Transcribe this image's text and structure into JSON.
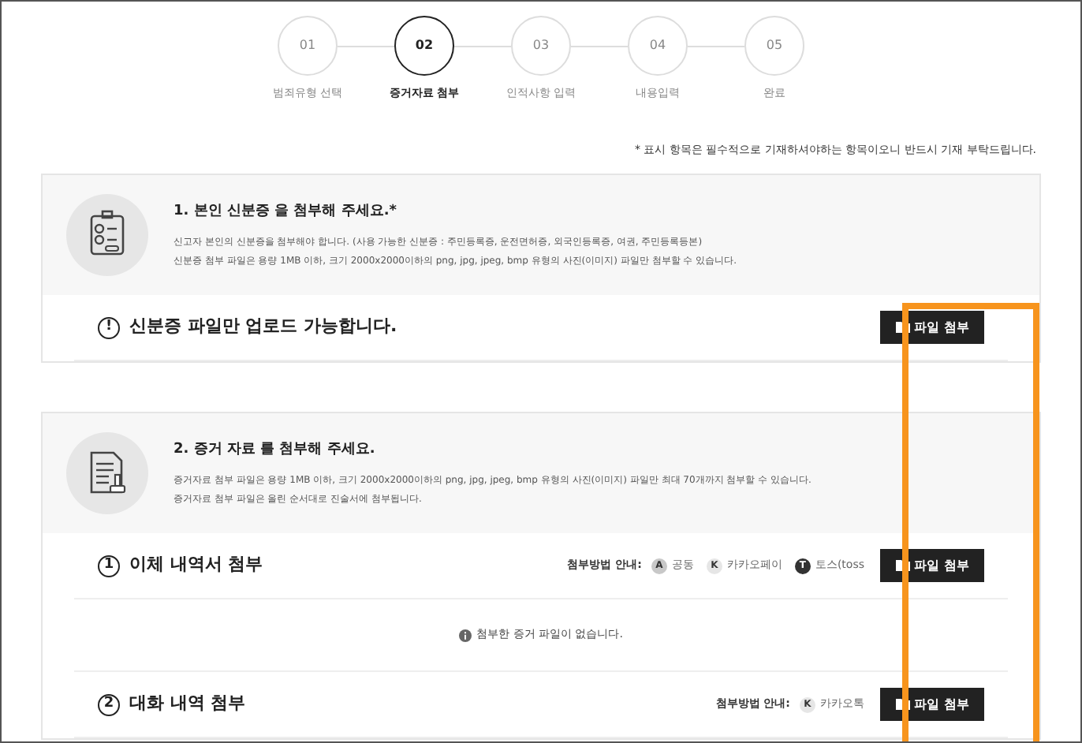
{
  "steps": [
    {
      "number": "01",
      "label": "범죄유형 선택",
      "selected": false
    },
    {
      "number": "02",
      "label": "증거자료 첨부",
      "selected": true
    },
    {
      "number": "03",
      "label": "인적사항 입력",
      "selected": false
    },
    {
      "number": "04",
      "label": "내용입력",
      "selected": false
    },
    {
      "number": "05",
      "label": "완료",
      "selected": false
    }
  ],
  "required_note": "* 표시 항목은 필수적으로 기재하셔야하는 항목이오니 반드시 기재 부탁드립니다.",
  "sections": [
    {
      "kind": "id",
      "title": "1. 본인 신분증 을 첨부해 주세요.*",
      "notes": [
        "신고자 본인의 신분증을 첨부해야 합니다. (사용 가능한 신분증 : 주민등록증, 운전면허증, 외국인등록증, 여권, 주민등록등본)",
        "신분증 첨부 파일은 용량 1MB 이하, 크기 2000x2000이하의 png, jpg, jpeg, bmp 유형의 사진(이미지) 파일만 첨부할 수 있습니다."
      ],
      "uploads": [
        {
          "number": "!",
          "label": "신분증 파일만 업로드 가능합니다.",
          "button": "파일 첨부"
        }
      ]
    },
    {
      "kind": "document",
      "title": "2. 증거 자료 를 첨부해 주세요.",
      "notes": [
        "증거자료 첨부 파일은 용량 1MB 이하, 크기 2000x2000이하의 png, jpg, jpeg, bmp 유형의 사진(이미지) 파일만 최대 70개까지 첨부할 수 있습니다.",
        "증거자료 첨부 파일은 올린 순서대로 진술서에 첨부됩니다."
      ],
      "uploads": [
        {
          "number": "1",
          "label": "이체 내역서 첨부",
          "button": "파일 첨부",
          "guide_label": "첨부방법 안내:",
          "guides": [
            {
              "letter": "A",
              "name": "공동",
              "color": "#c8c8c8"
            },
            {
              "letter": "K",
              "name": "카카오페이",
              "color": "#e6e6e6"
            },
            {
              "letter": "T",
              "name": "토스(toss",
              "color": "#333333"
            }
          ],
          "empty": "첨부한 증거 파일이 없습니다."
        },
        {
          "number": "2",
          "label": "대화 내역 첨부",
          "button": "파일 첨부",
          "guide_label": "첨부방법 안내:",
          "guides": [
            {
              "letter": "K",
              "name": "카카오톡",
              "color": "#e6e6e6"
            }
          ]
        }
      ]
    }
  ]
}
